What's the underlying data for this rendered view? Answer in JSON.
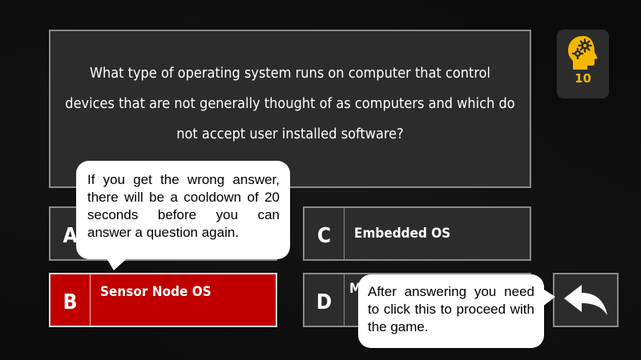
{
  "question": {
    "text": "What type of operating system runs on computer that control devices that are not generally thought of as computers and which do not accept user installed software?"
  },
  "score": {
    "icon": "brain-gears-icon",
    "value": "10",
    "accent_color": "#f5b800"
  },
  "answers": [
    {
      "letter": "A",
      "label": ""
    },
    {
      "letter": "B",
      "label": "Sensor Node OS",
      "selected": true
    },
    {
      "letter": "C",
      "label": "Embedded OS"
    },
    {
      "letter": "D",
      "label": "M"
    }
  ],
  "selected_color": "#c00000",
  "back_button": {
    "icon": "reply-arrow-icon"
  },
  "tooltips": {
    "wrong_answer": "If you get the wrong answer, there will be a cooldown of 20 seconds before you can answer a question again.",
    "proceed": "After answering you need to click this to proceed with the game."
  }
}
